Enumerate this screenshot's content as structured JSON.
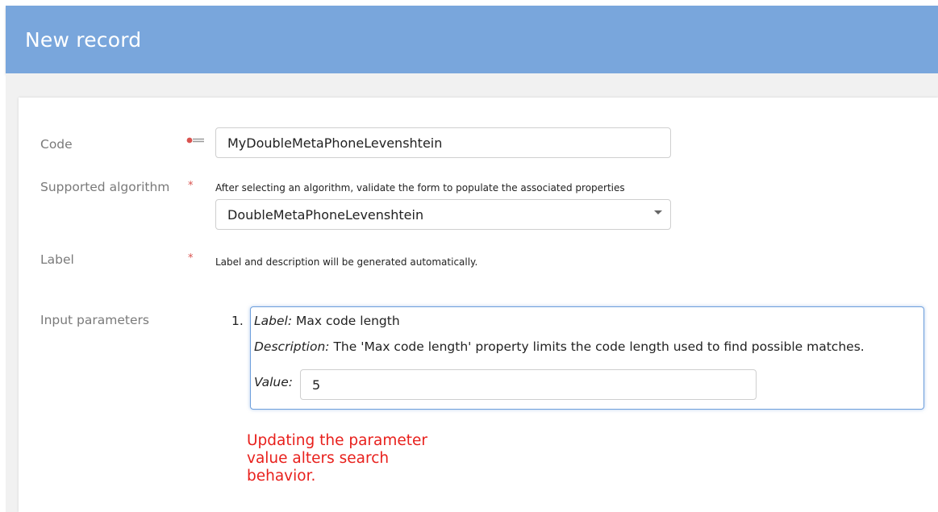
{
  "header": {
    "title": "New record"
  },
  "form": {
    "code": {
      "label": "Code",
      "value": "MyDoubleMetaPhoneLevenshtein",
      "icon": "primary-key-icon"
    },
    "algorithm": {
      "label": "Supported algorithm",
      "required_mark": "*",
      "hint": "After selecting an algorithm, validate the form to populate the associated properties",
      "selected": "DoubleMetaPhoneLevenshtein"
    },
    "label_field": {
      "label": "Label",
      "required_mark": "*",
      "hint": "Label and description will be generated automatically."
    },
    "input_parameters": {
      "label": "Input parameters",
      "items": [
        {
          "index": "1.",
          "label_key": "Label:",
          "label_value": "Max code length",
          "description_key": "Description:",
          "description_value": "The 'Max code length' property limits the code length used to find possible matches.",
          "value_key": "Value:",
          "value": "5"
        }
      ]
    }
  },
  "annotation": {
    "text": "Updating the parameter value alters search behavior."
  },
  "colors": {
    "header_bg": "#79a6dc",
    "accent_border": "#6e9fdc",
    "required": "#d9534f",
    "annotation": "#e8201c"
  }
}
